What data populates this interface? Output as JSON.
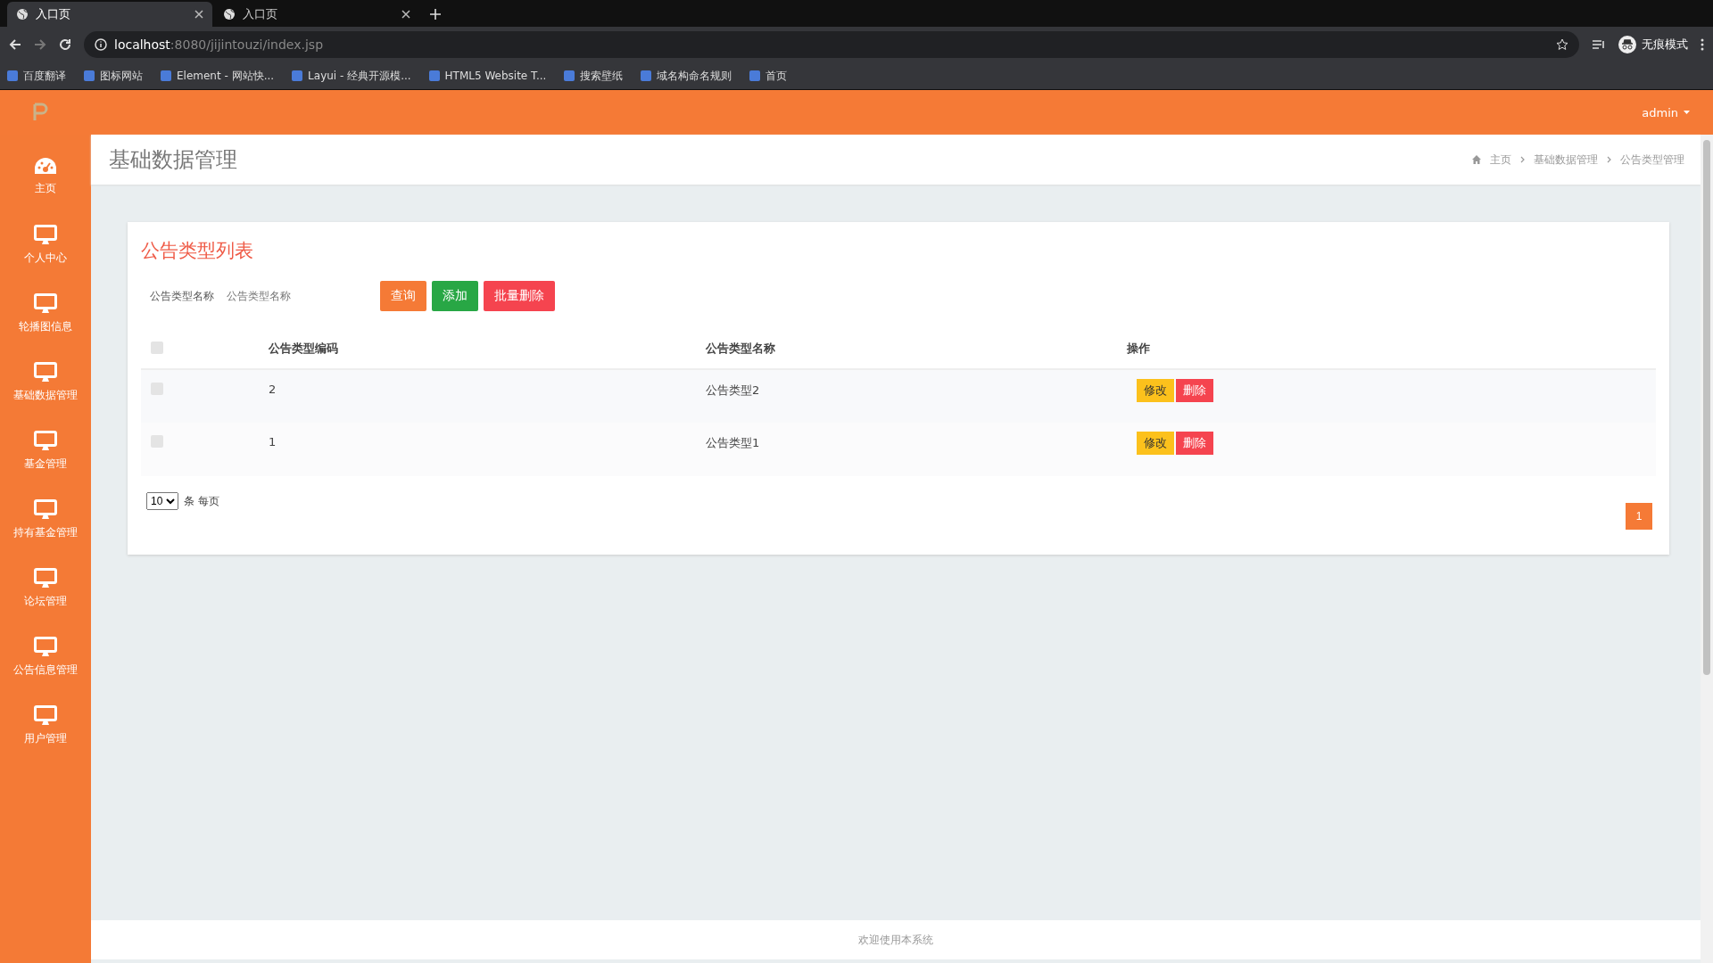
{
  "browser": {
    "tabs": [
      {
        "title": "入口页",
        "selected": true
      },
      {
        "title": "入口页",
        "selected": false
      }
    ],
    "url_host": "localhost",
    "url_path": ":8080/jijintouzi/index.jsp",
    "profile": "无痕模式",
    "bookmarks": [
      "百度翻译",
      "图标网站",
      "Element - 网站快...",
      "Layui - 经典开源模...",
      "HTML5 Website T...",
      "搜索壁纸",
      "域名构命名规则",
      "首页"
    ]
  },
  "header": {
    "user": "admin"
  },
  "sidebar": {
    "items": [
      {
        "label": "主页"
      },
      {
        "label": "个人中心"
      },
      {
        "label": "轮播图信息"
      },
      {
        "label": "基础数据管理"
      },
      {
        "label": "基金管理"
      },
      {
        "label": "持有基金管理"
      },
      {
        "label": "论坛管理"
      },
      {
        "label": "公告信息管理"
      },
      {
        "label": "用户管理"
      }
    ]
  },
  "page": {
    "title": "基础数据管理",
    "breadcrumb": [
      "主页",
      "基础数据管理",
      "公告类型管理"
    ]
  },
  "card": {
    "title": "公告类型列表",
    "search": {
      "label": "公告类型名称",
      "placeholder": "公告类型名称"
    },
    "buttons": [
      {
        "label": "查询",
        "kind": "search"
      },
      {
        "label": "添加",
        "kind": "add"
      },
      {
        "label": "批量删除",
        "kind": "delete"
      }
    ],
    "table": {
      "all_checked": false,
      "columns": [
        "公告类型编码",
        "公告类型名称",
        "操作"
      ],
      "rows": [
        {
          "checked": false,
          "code": "2",
          "name": "公告类型2",
          "actions": [
            "修改",
            "删除"
          ]
        },
        {
          "checked": false,
          "code": "1",
          "name": "公告类型1",
          "actions": [
            "修改",
            "删除"
          ]
        }
      ]
    },
    "page_size": "10",
    "page_size_label": "条 每页",
    "pages": [
      {
        "label": "1",
        "selected": true
      }
    ]
  },
  "footer": "欢迎使用本系统"
}
